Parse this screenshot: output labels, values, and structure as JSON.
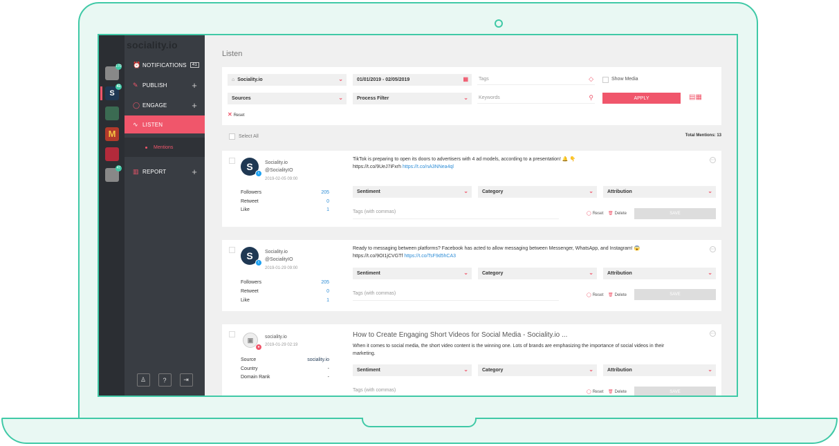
{
  "app": {
    "logo": "sociality.io"
  },
  "colors": {
    "accent": "#f0566b",
    "link": "#2c8cd6",
    "frame": "#3fc9a6",
    "sidebar": "#393d43"
  },
  "brands": [
    {
      "name": "brand-1",
      "badge": "170",
      "color": "#888"
    },
    {
      "name": "brand-sociality",
      "badge": "41",
      "color": "#1f3853"
    },
    {
      "name": "brand-starbucks",
      "badge": "",
      "color": "#3b6b52"
    },
    {
      "name": "brand-mcdonalds",
      "badge": "",
      "color": "#b23a2b"
    },
    {
      "name": "brand-cocacola",
      "badge": "",
      "color": "#b22a3b"
    },
    {
      "name": "brand-6",
      "badge": "47",
      "color": "#888"
    }
  ],
  "nav": {
    "notifications": {
      "label": "NOTIFICATIONS",
      "count": "41"
    },
    "publish": {
      "label": "PUBLISH"
    },
    "engage": {
      "label": "ENGAGE"
    },
    "listen": {
      "label": "LISTEN"
    },
    "mentions": {
      "label": "Mentions"
    },
    "report": {
      "label": "REPORT"
    },
    "bottom": {
      "user": "♙",
      "help": "?",
      "logout": "⇥"
    }
  },
  "page": {
    "title": "Listen"
  },
  "filters": {
    "brand": "Sociality.io",
    "date_range": "01/01/2019 - 02/05/2019",
    "tags_placeholder": "Tags",
    "show_media": "Show Media",
    "sources": "Sources",
    "process_filter": "Process Filter",
    "keywords_placeholder": "Keywords",
    "apply": "APPLY",
    "reset": "Reset"
  },
  "list": {
    "select_all": "Select All",
    "total": "Total Mentions: 13"
  },
  "dropdowns": {
    "sentiment": "Sentiment",
    "category": "Category",
    "attribution": "Attribution"
  },
  "actions": {
    "tags_placeholder": "Tags (with commas)",
    "reset": "Reset",
    "delete": "Delete",
    "save": "SAVE"
  },
  "mentions": [
    {
      "name": "Sociality.io",
      "handle": "@SocialityIO",
      "date": "2019-02-05 09:00",
      "stats": [
        {
          "label": "Followers",
          "value": "205"
        },
        {
          "label": "Retweet",
          "value": "0"
        },
        {
          "label": "Like",
          "value": "1"
        }
      ],
      "text": "TikTok is preparing to open its doors to advertisers with 4 ad models, according to a presentation! 🔔 👇",
      "link_plain": "https://t.co/9UeJ7iFxrh",
      "link": "https://t.co/nA3NNea4ql"
    },
    {
      "name": "Sociality.io",
      "handle": "@SocialityIO",
      "date": "2019-01-29 09:00",
      "stats": [
        {
          "label": "Followers",
          "value": "205"
        },
        {
          "label": "Retweet",
          "value": "0"
        },
        {
          "label": "Like",
          "value": "1"
        }
      ],
      "text": "Ready to messaging between platforms? Facebook has acted to allow messaging between Messenger, WhatsApp, and Instagram! 😱",
      "link_plain": "https://t.co/9OI1jCVGTf",
      "link": "https://t.co/TsF9d5hCA3"
    },
    {
      "name": "sociality.io",
      "date": "2019-01-29 02:19",
      "headline": "How to Create Engaging Short Videos for Social Media - Sociality.io ...",
      "text": "When it comes to social media, the short video content is the winning one. Lots of brands are emphasizing the importance of social videos in their marketing.",
      "stats": [
        {
          "label": "Source",
          "value": "sociality.io"
        },
        {
          "label": "Country",
          "value": "-"
        },
        {
          "label": "Domain Rank",
          "value": "-"
        }
      ]
    }
  ]
}
